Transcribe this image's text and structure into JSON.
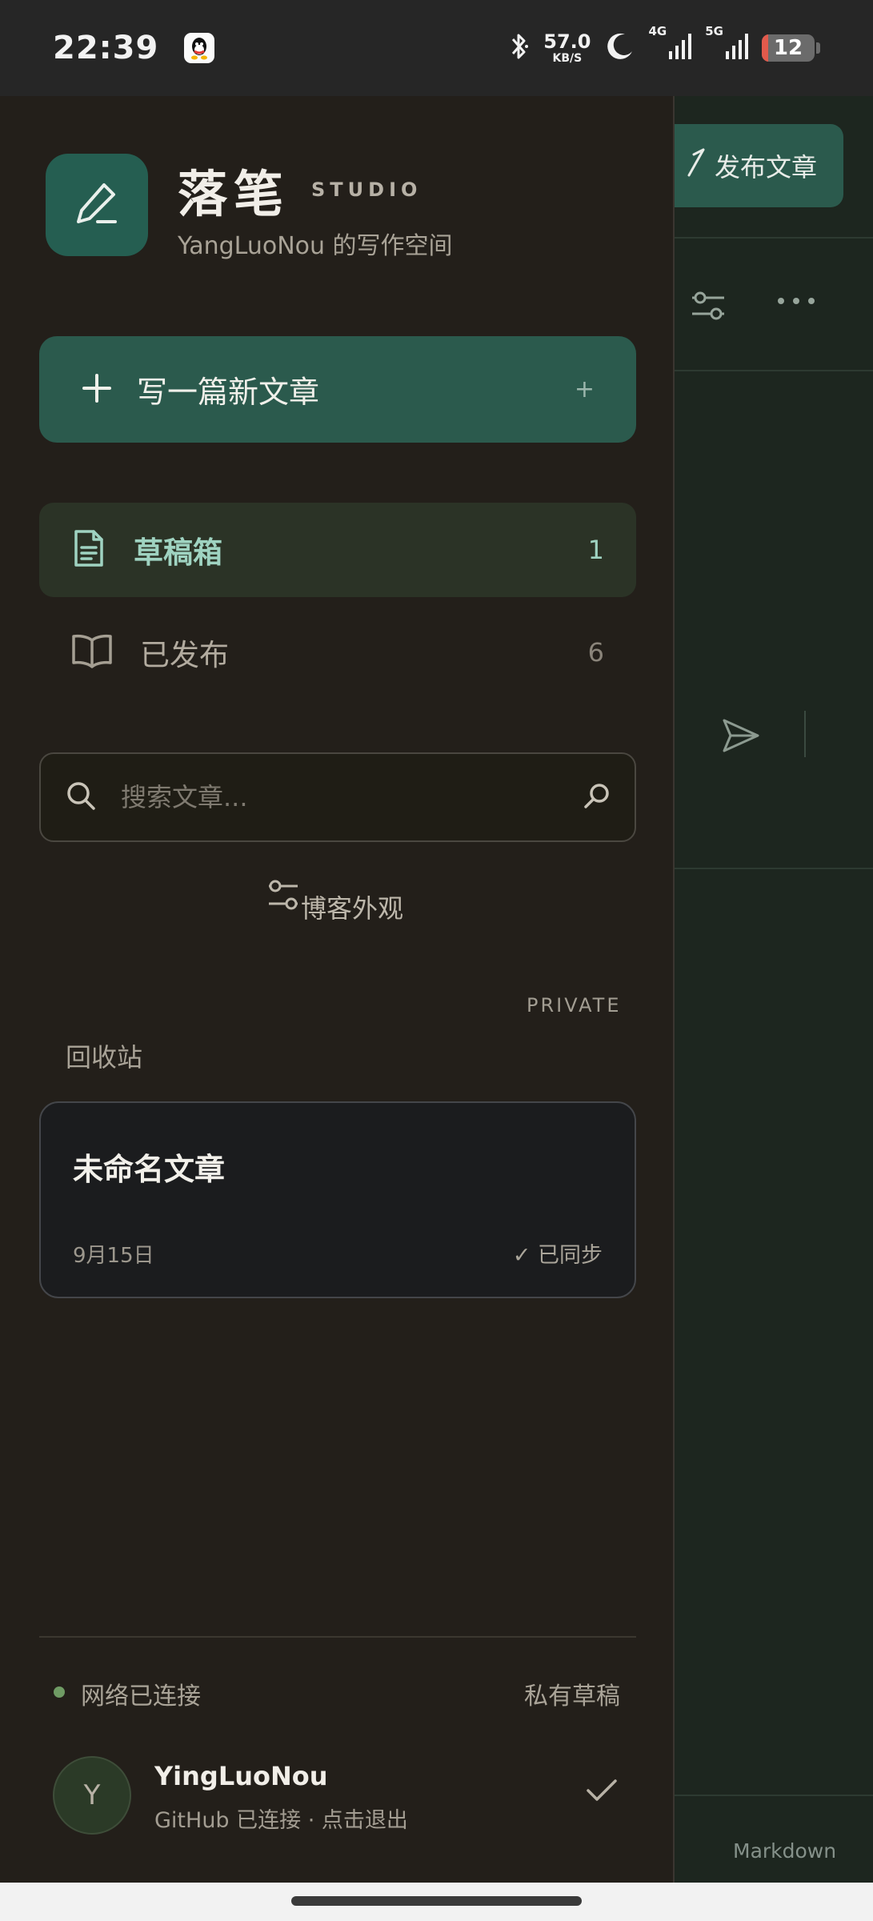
{
  "status_bar": {
    "time": "22:39",
    "speed_value": "57.0",
    "speed_unit": "KB/S",
    "net1": "4G",
    "net2": "5G",
    "battery": "12",
    "battery_level_percent": 12,
    "battery_color": "#e25a4c"
  },
  "editor": {
    "publish_label": "发布文章",
    "mode_label": "Markdown"
  },
  "drawer": {
    "brand_title": "落笔",
    "brand_tag": "STUDIO",
    "brand_subtitle": "YangLuoNou 的写作空间",
    "new_post_label": "写一篇新文章",
    "new_post_plus": "+",
    "nav": [
      {
        "label": "草稿箱",
        "count": "1",
        "icon": "document-icon",
        "active": true
      },
      {
        "label": "已发布",
        "count": "6",
        "icon": "book-open-icon",
        "active": false
      }
    ],
    "search": {
      "placeholder": "搜索文章..."
    },
    "appearance_label": "博客外观",
    "private_label": "PRIVATE",
    "trash_label": "回收站",
    "posts": [
      {
        "title": "未命名文章",
        "date": "9月15日",
        "sync": "✓ 已同步"
      }
    ],
    "footer": {
      "network_status": "网络已连接",
      "private_drafts": "私有草稿",
      "network_dot_color": "#6f9b64"
    },
    "user": {
      "avatar_letter": "Y",
      "name": "YingLuoNou",
      "status": "GitHub 已连接 · 点击退出"
    }
  },
  "colors": {
    "accent": "#2b5a4d",
    "active_text": "#9fd3c1",
    "drawer_bg": "#231f1a"
  }
}
